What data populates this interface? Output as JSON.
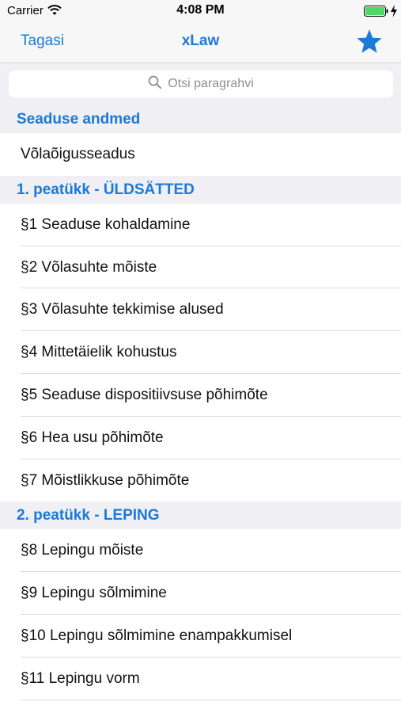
{
  "status_bar": {
    "carrier": "Carrier",
    "time": "4:08 PM",
    "wifi_icon": "wifi-icon",
    "battery_icon": "battery-full-icon",
    "charging_icon": "bolt-icon"
  },
  "nav": {
    "back_label": "Tagasi",
    "title": "xLaw",
    "favorite_icon": "star-icon"
  },
  "search": {
    "placeholder": "Otsi paragrahvi",
    "icon": "search-icon"
  },
  "sections": [
    {
      "header": "Seaduse andmed",
      "rows": [
        "Võlaõigusseadus"
      ]
    },
    {
      "header": "1. peatükk - ÜLDSÄTTED",
      "rows": [
        "§1 Seaduse kohaldamine",
        "§2 Võlasuhte mõiste",
        "§3 Võlasuhte tekkimise alused",
        "§4 Mittetäielik kohustus",
        "§5 Seaduse dispositiivsuse põhimõte",
        "§6 Hea usu põhimõte",
        "§7 Mõistlikkuse põhimõte"
      ]
    },
    {
      "header": "2. peatükk - LEPING",
      "rows": [
        "§8 Lepingu mõiste",
        "§9 Lepingu sõlmimine",
        "§10 Lepingu sõlmimine enampakkumisel",
        "§11 Lepingu vorm"
      ]
    }
  ],
  "colors": {
    "accent": "#1a7ad8",
    "bar_background": "#f7f7f7",
    "section_background": "#efeff4",
    "separator": "#dcdce0"
  }
}
